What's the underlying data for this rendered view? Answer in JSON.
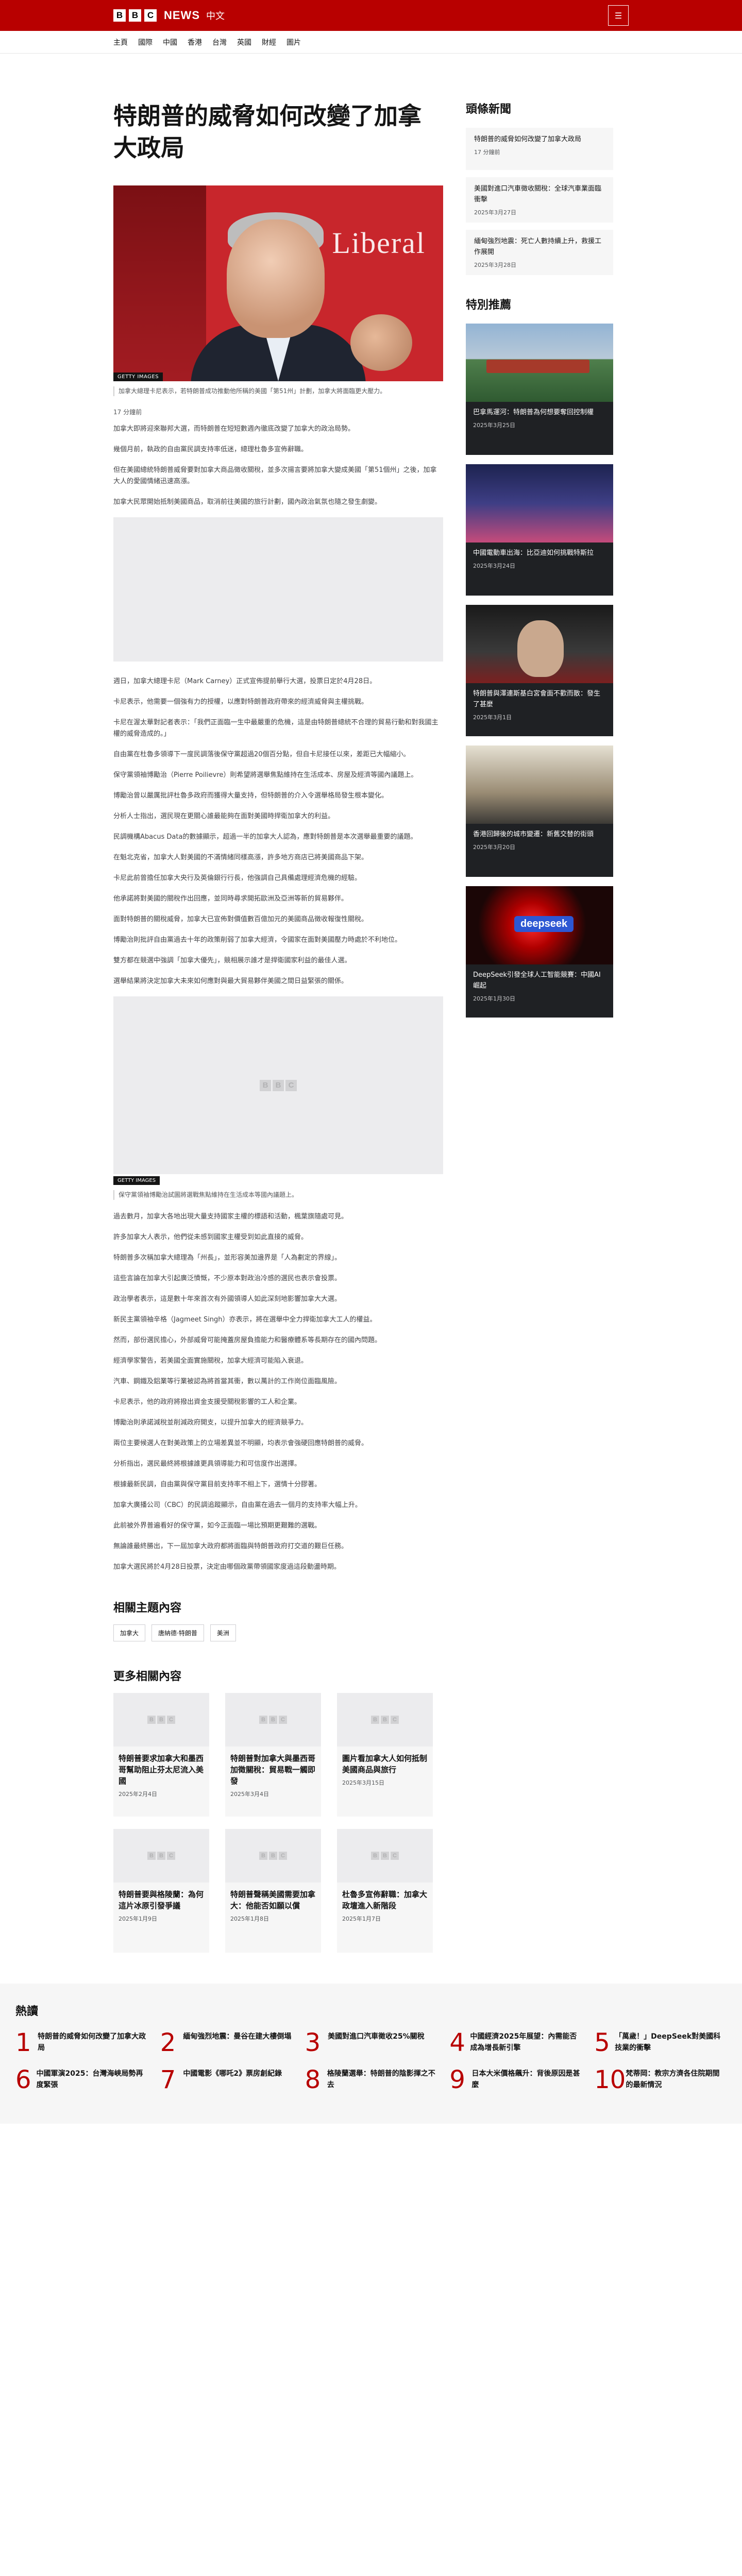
{
  "header": {
    "logo_letters": [
      "B",
      "B",
      "C"
    ],
    "logo_word": "NEWS",
    "logo_lang": "中文",
    "menu_icon": "menu-icon",
    "menu_glyph": "☰"
  },
  "nav": [
    "主頁",
    "國際",
    "中國",
    "香港",
    "台灣",
    "英國",
    "財經",
    "圖片"
  ],
  "article": {
    "headline": "特朗普的威脅如何改變了加拿大政局",
    "hero_tag": "GETTY IMAGES",
    "hero_caption": "加拿大總理卡尼表示，若特朗普成功推動他所稱的美國「第51州」計劃，加拿大將面臨更大壓力。",
    "byline": "17 分鐘前",
    "paras_a": [
      "加拿大即將迎來聯邦大選，而特朗普在短短數週內徹底改變了加拿大的政治局勢。",
      "幾個月前，執政的自由黨民調支持率低迷，總理杜魯多宣佈辭職。",
      "但在美國總統特朗普威脅要對加拿大商品徵收關稅，並多次揚言要將加拿大變成美國「第51個州」之後，加拿大人的愛國情緒迅速高漲。",
      "加拿大民眾開始抵制美國商品，取消前往美國的旅行計劃，國內政治氣氛也隨之發生劇變。"
    ],
    "paras_b": [
      "週日，加拿大總理卡尼（Mark Carney）正式宣佈提前舉行大選，投票日定於4月28日。",
      "卡尼表示，他需要一個強有力的授權，以應對特朗普政府帶來的經濟威脅與主權挑戰。",
      "卡尼在渥太華對記者表示：「我們正面臨一生中最嚴重的危機，這是由特朗普總統不合理的貿易行動和對我國主權的威脅造成的。」",
      "自由黨在杜魯多領導下一度民調落後保守黨超過20個百分點，但自卡尼接任以來，差距已大幅縮小。",
      "保守黨領袖博勵治（Pierre Poilievre）則希望將選舉焦點維持在生活成本、房屋及經濟等國內議題上。",
      "博勵治曾以嚴厲批評杜魯多政府而獲得大量支持，但特朗普的介入令選舉格局發生根本變化。",
      "分析人士指出，選民現在更關心誰最能夠在面對美國時捍衛加拿大的利益。",
      "民調機構Abacus Data的數據顯示，超過一半的加拿大人認為，應對特朗普是本次選舉最重要的議題。",
      "在魁北克省，加拿大人對美國的不滿情緒同樣高漲，許多地方商店已將美國商品下架。",
      "卡尼此前曾擔任加拿大央行及英倫銀行行長，他強調自己具備處理經濟危機的經驗。",
      "他承諾將對美國的關稅作出回應，並同時尋求開拓歐洲及亞洲等新的貿易夥伴。",
      "面對特朗普的關稅威脅，加拿大已宣佈對價值數百億加元的美國商品徵收報復性關稅。",
      "博勵治則批評自由黨過去十年的政策削弱了加拿大經濟，令國家在面對美國壓力時處於不利地位。",
      "雙方都在競選中強調「加拿大優先」，競相展示誰才是捍衛國家利益的最佳人選。",
      "選舉結果將決定加拿大未來如何應對與最大貿易夥伴美國之間日益緊張的關係。"
    ],
    "image2_tag": "GETTY IMAGES",
    "image2_caption": "保守黨領袖博勵治試圖將選戰焦點維持在生活成本等國內議題上。",
    "paras_c": [
      "過去數月，加拿大各地出現大量支持國家主權的標語和活動，楓葉旗隨處可見。",
      "許多加拿大人表示，他們從未感到國家主權受到如此直接的威脅。",
      "特朗普多次稱加拿大總理為「州長」，並形容美加邊界是「人為劃定的界線」。",
      "這些言論在加拿大引起廣泛憤慨，不少原本對政治冷感的選民也表示會投票。",
      "政治學者表示，這是數十年來首次有外國領導人如此深刻地影響加拿大大選。",
      "新民主黨領袖辛格（Jagmeet Singh）亦表示，將在選舉中全力捍衛加拿大工人的權益。",
      "然而，部份選民擔心，外部威脅可能掩蓋房屋負擔能力和醫療體系等長期存在的國內問題。",
      "經濟學家警告，若美國全面實施關稅，加拿大經濟可能陷入衰退。",
      "汽車、鋼鐵及鋁業等行業被認為將首當其衝，數以萬計的工作崗位面臨風險。",
      "卡尼表示，他的政府將撥出資金支援受關稅影響的工人和企業。",
      "博勵治則承諾減稅並削減政府開支，以提升加拿大的經濟競爭力。",
      "兩位主要候選人在對美政策上的立場差異並不明顯，均表示會強硬回應特朗普的威脅。",
      "分析指出，選民最終將根據誰更具領導能力和可信度作出選擇。",
      "根據最新民調，自由黨與保守黨目前支持率不相上下，選情十分膠著。",
      "加拿大廣播公司（CBC）的民調追蹤顯示，自由黨在過去一個月的支持率大幅上升。",
      "此前被外界普遍看好的保守黨，如今正面臨一場比預期更艱難的選戰。",
      "無論誰最終勝出，下一屆加拿大政府都將面臨與特朗普政府打交道的艱巨任務。",
      "加拿大選民將於4月28日投票，決定由哪個政黨帶領國家度過這段動盪時期。"
    ]
  },
  "related_topics": {
    "heading": "相關主題內容",
    "items": [
      "加拿大",
      "唐納德·特朗普",
      "美洲"
    ]
  },
  "more": {
    "heading": "更多相關內容",
    "cards": [
      {
        "title": "特朗普要求加拿大和墨西哥幫助阻止芬太尼流入美國",
        "date": "2025年2月4日"
      },
      {
        "title": "特朗普對加拿大與墨西哥加徵關稅：貿易戰一觸即發",
        "date": "2025年3月4日"
      },
      {
        "title": "圖片看加拿大人如何抵制美國商品與旅行",
        "date": "2025年3月15日"
      },
      {
        "title": "特朗普要與格陵蘭：為何這片冰原引發爭議",
        "date": "2025年1月9日"
      },
      {
        "title": "特朗普聲稱美國需要加拿大：他能否如願以償",
        "date": "2025年1月8日"
      },
      {
        "title": "杜魯多宣佈辭職：加拿大政壇進入新階段",
        "date": "2025年1月7日"
      }
    ]
  },
  "sidebar": {
    "latest_heading": "頭條新聞",
    "latest": [
      {
        "title": "特朗普的威脅如何改變了加拿大政局",
        "date": "17 分鐘前"
      },
      {
        "title": "美國對進口汽車徵收關稅：全球汽車業面臨衝擊",
        "date": "2025年3月27日"
      },
      {
        "title": "緬甸強烈地震：死亡人數持續上升，救援工作展開",
        "date": "2025年3月28日"
      }
    ],
    "reco_heading": "特別推薦",
    "reco": [
      {
        "title": "巴拿馬運河：特朗普為何想要奪回控制權",
        "date": "2025年3月25日"
      },
      {
        "title": "中國電動車出海：比亞迪如何挑戰特斯拉",
        "date": "2025年3月24日"
      },
      {
        "title": "特朗普與澤連斯基白宮會面不歡而散：發生了甚麼",
        "date": "2025年3月1日"
      },
      {
        "title": "香港回歸後的城市變遷：新舊交替的街頭",
        "date": "2025年3月20日"
      },
      {
        "title": "DeepSeek引發全球人工智能競賽：中國AI崛起",
        "date": "2025年1月30日"
      }
    ]
  },
  "popular": {
    "heading": "熱讀",
    "items": [
      {
        "num": "1",
        "title": "特朗普的威脅如何改變了加拿大政局"
      },
      {
        "num": "2",
        "title": "緬甸強烈地震：曼谷在建大樓倒塌"
      },
      {
        "num": "3",
        "title": "美國對進口汽車徵收25%關稅"
      },
      {
        "num": "4",
        "title": "中國經濟2025年展望：內需能否成為增長新引擎"
      },
      {
        "num": "5",
        "title": "「萬歲！」DeepSeek對美國科技業的衝擊"
      },
      {
        "num": "6",
        "title": "中國軍演2025：台灣海峽局勢再度緊張"
      },
      {
        "num": "7",
        "title": "中國電影《哪吒2》票房創紀錄"
      },
      {
        "num": "8",
        "title": "格陵蘭選舉：特朗普的陰影揮之不去"
      },
      {
        "num": "9",
        "title": "日本大米價格飆升：背後原因是甚麼"
      },
      {
        "num": "10",
        "title": "梵蒂岡：教宗方濟各住院期間的最新情況"
      }
    ]
  }
}
